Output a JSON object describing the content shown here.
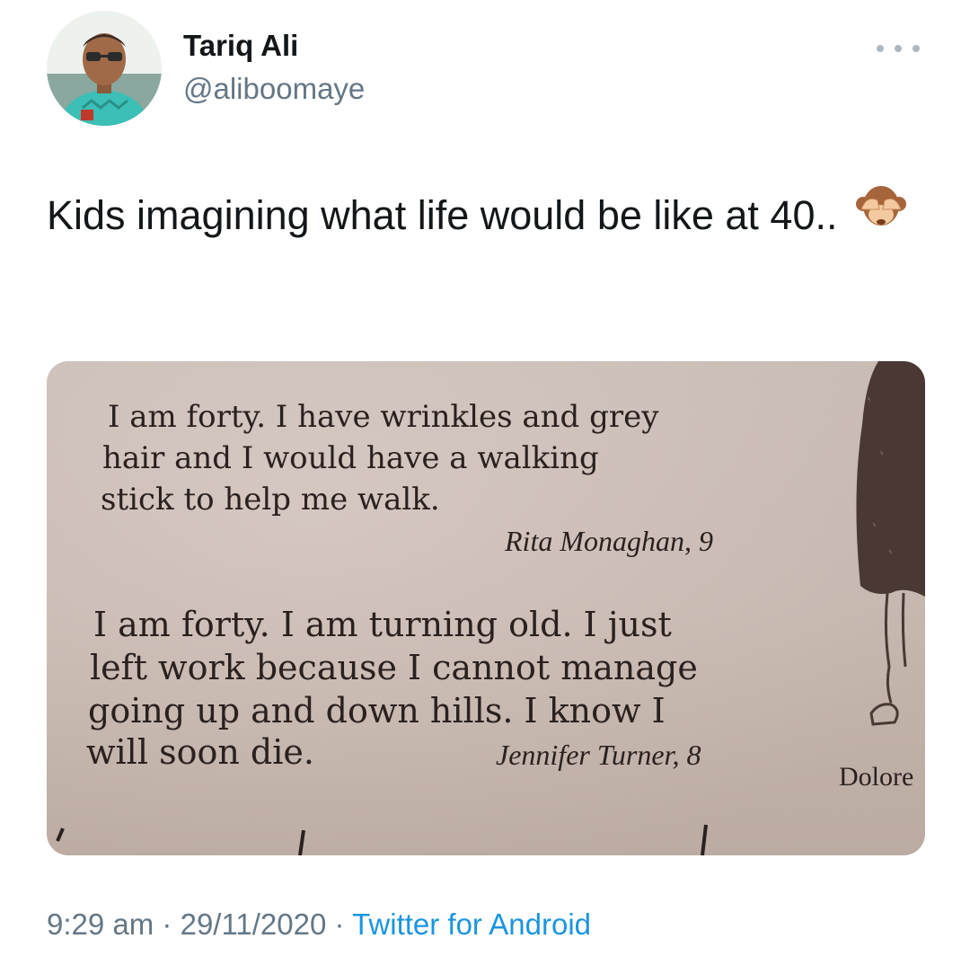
{
  "user": {
    "name": "Tariq Ali",
    "handle": "@aliboomaye"
  },
  "tweet": {
    "text": "Kids imagining what life would be like at 40..",
    "emoji": "see-no-evil-monkey-icon"
  },
  "photo": {
    "quote1_lines": [
      "I am forty. I have wrinkles and grey",
      "hair and I would have a walking",
      "stick to help me walk."
    ],
    "quote1_author": "Rita Monaghan, 9",
    "quote2_lines": [
      "I am forty. I am turning old. I just",
      "left work because I cannot manage",
      "going up and down hills. I know I",
      "will soon die."
    ],
    "quote2_author": "Jennifer Turner, 8",
    "side_caption": "Dolore"
  },
  "footer": {
    "time": "9:29 am",
    "separator": "·",
    "date": "29/11/2020",
    "source": "Twitter for Android"
  },
  "colors": {
    "name": "#14171a",
    "secondary": "#657786",
    "link": "#1b95e0"
  }
}
